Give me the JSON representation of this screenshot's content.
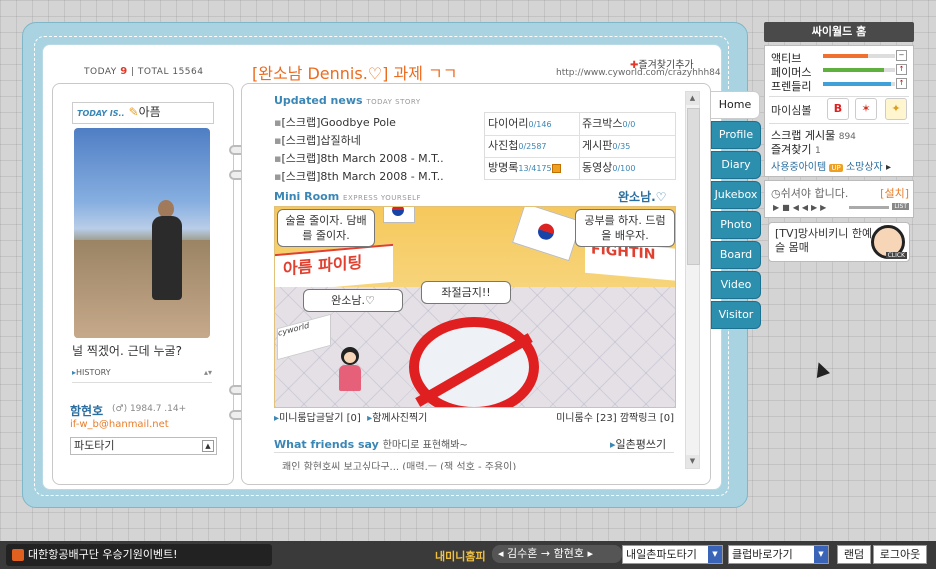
{
  "header": {
    "today_label": "TODAY",
    "today_count": "9",
    "total_label": "TOTAL",
    "total_count": "15564",
    "title": "[완소남 Dennis.♡] 과제 ㄱㄱ",
    "favorite": "즐겨찾기추가",
    "url": "http://www.cyworld.com/crazyhhh84"
  },
  "profile": {
    "today_is_label": "TODAY IS..",
    "today_mood": "아픔",
    "caption": "널 찍겠어. 근데 누굴?",
    "history": "HISTORY",
    "name": "함현호",
    "gender_birth": "(♂) 1984.7 .14+",
    "email": "if-w_b@hanmail.net",
    "wave_select": "파도타기"
  },
  "updated": {
    "title": "Updated news",
    "sub": "TODAY STORY",
    "items": [
      "[스크랩]Goodbye Pole",
      "[스크랩]삽질하네",
      "[스크랩]8th March 2008 - M.T..",
      "[스크랩]8th March 2008 - M.T.."
    ],
    "counts": [
      {
        "label": "다이어리",
        "num": "0/146"
      },
      {
        "label": "쥬크박스",
        "num": "0/0"
      },
      {
        "label": "사진첩",
        "num": "0/2587"
      },
      {
        "label": "게시판",
        "num": "0/35"
      },
      {
        "label": "방명록",
        "num": "13/4175"
      },
      {
        "label": "동영상",
        "num": "0/100"
      }
    ]
  },
  "miniroom": {
    "title": "Mini Room",
    "sub": "EXPRESS YOURSELF",
    "owner": "완소남.♡",
    "bubble1": "술을 줄이자. 담배를 줄이자.",
    "bubble2": "공부를 하자. 드럼을 배우자.",
    "bubble3": "완소남.♡",
    "bubble4": "좌절금지!!",
    "banner_left": "아름 파이팅",
    "banner_right": "FIGHTIN",
    "board_sign": "cyworld",
    "comment": "미니룸답글달기",
    "comment_count": "[0]",
    "photo": "함께사진찍기",
    "visit_label": "미니룸수",
    "visit_count": "[23]",
    "link_label": "깜짝링크",
    "link_count": "[0]"
  },
  "friends": {
    "title": "What friends say",
    "hand": "한마디로 표현해봐~",
    "write": "일촌평쓰기",
    "text": "쾌인 함현호씨 보고싶다구...  (매력.ㅡ (잭 석호 - 주용이)"
  },
  "tabs": [
    "Home",
    "Profile",
    "Diary",
    "Jukebox",
    "Photo",
    "Board",
    "Video",
    "Visitor"
  ],
  "side": {
    "home": "싸이월드 홈",
    "stats": [
      {
        "label": "액티브",
        "level": 0.62,
        "color": "#f07030"
      },
      {
        "label": "페이머스",
        "level": 0.85,
        "color": "#60b040"
      },
      {
        "label": "프렌들리",
        "level": 0.95,
        "color": "#40a0d8"
      }
    ],
    "symbol_label": "마이심볼",
    "scrap_label": "스크랩 게시물",
    "scrap_count": "894",
    "fav_label": "즐겨찾기",
    "fav_count": "1",
    "used_items": "사용중아이템",
    "gift_box": "소망상자",
    "music_title": "쉬셔야 합니다.",
    "music_setup": "[설치]",
    "music_list": "LIST",
    "tv_text": "[TV]망사비키니 한예슬 몸매",
    "tv_click": "CLICK"
  },
  "bottom": {
    "event": "대한항공배구단 우승기원이벤트!",
    "mini_home": "내미니홈피",
    "path_from": "김수혼",
    "path_to": "함현호",
    "wave_select": "내일촌파도타기",
    "club_select": "클럽바로가기",
    "random": "랜덤",
    "logout": "로그아웃"
  }
}
